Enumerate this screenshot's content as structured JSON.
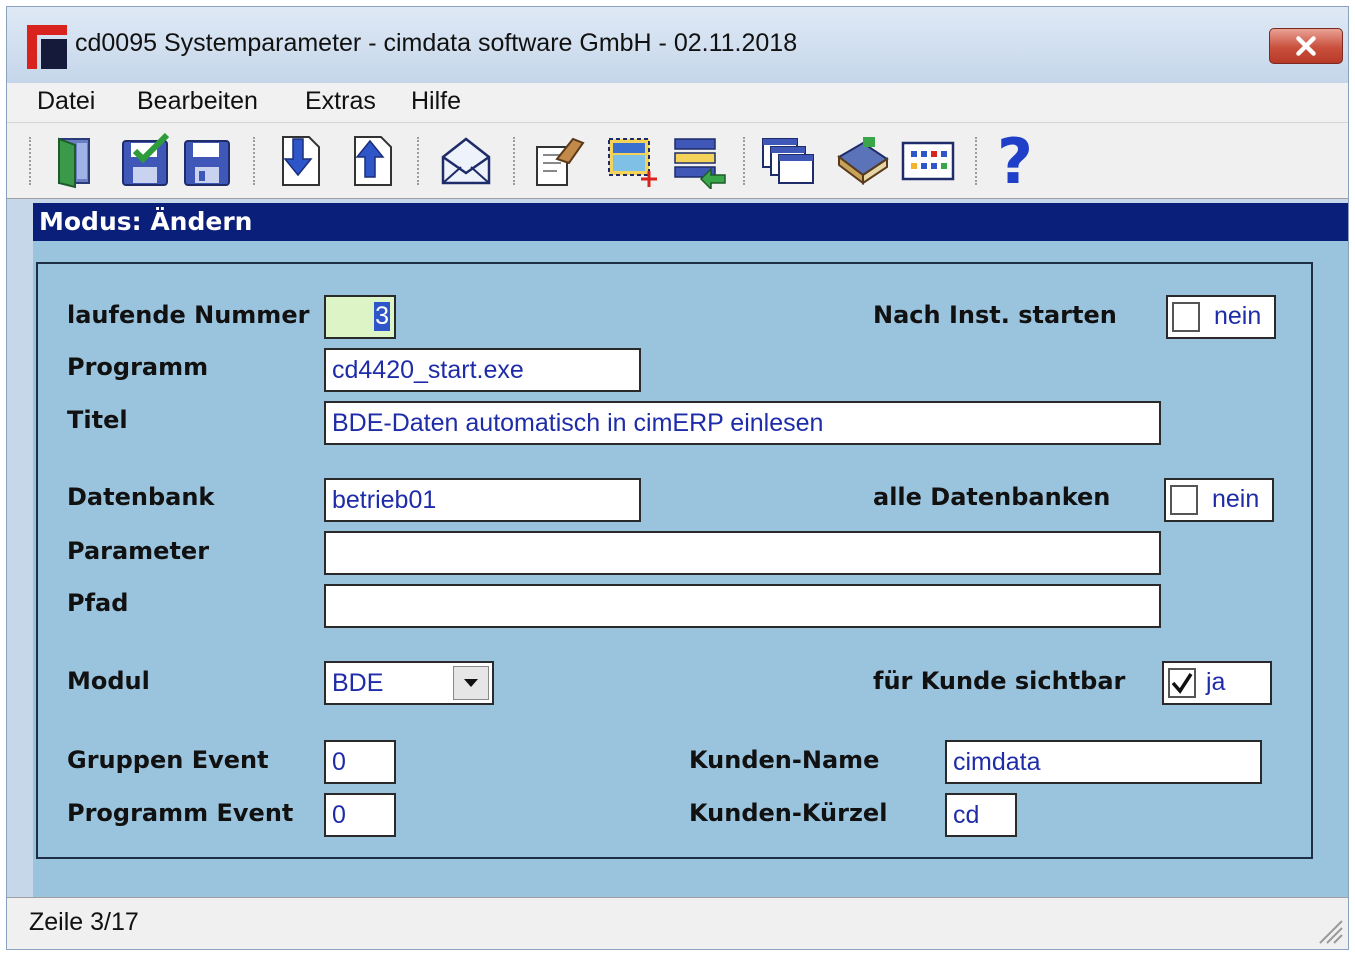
{
  "window": {
    "title": "cd0095 Systemparameter - cimdata software GmbH - 02.11.2018",
    "close_icon": "close-icon"
  },
  "menu": {
    "items": [
      {
        "label": "Datei"
      },
      {
        "label": "Bearbeiten"
      },
      {
        "label": "Extras"
      },
      {
        "label": "Hilfe"
      }
    ]
  },
  "toolbar": {
    "icons": [
      "exit-door-icon",
      "save-check-icon",
      "save-icon",
      "arrow-down-icon",
      "arrow-up-icon",
      "envelope-icon",
      "edit-hand-icon",
      "select-add-icon",
      "list-import-icon",
      "windows-icon",
      "book-icon",
      "grid-view-icon",
      "help-icon"
    ],
    "help_glyph": "?"
  },
  "mode": {
    "text": "Modus: Ändern"
  },
  "form": {
    "laufende_nummer": {
      "label": "laufende Nummer",
      "value": "3"
    },
    "programm": {
      "label": "Programm",
      "value": "cd4420_start.exe"
    },
    "titel": {
      "label": "Titel",
      "value": "BDE-Daten automatisch in cimERP einlesen"
    },
    "datenbank": {
      "label": "Datenbank",
      "value": "betrieb01"
    },
    "parameter": {
      "label": "Parameter",
      "value": ""
    },
    "pfad": {
      "label": "Pfad",
      "value": ""
    },
    "modul": {
      "label": "Modul",
      "value": "BDE"
    },
    "gruppen_event": {
      "label": "Gruppen Event",
      "value": "0"
    },
    "programm_event": {
      "label": "Programm Event",
      "value": "0"
    },
    "nach_inst_starten": {
      "label": "Nach Inst. starten",
      "checked": false,
      "text": "nein"
    },
    "alle_datenbanken": {
      "label": "alle Datenbanken",
      "checked": false,
      "text": "nein"
    },
    "fuer_kunde_sichtbar": {
      "label": "für Kunde sichtbar",
      "checked": true,
      "text": "ja"
    },
    "kunden_name": {
      "label": "Kunden-Name",
      "value": "cimdata"
    },
    "kunden_kuerzel": {
      "label": "Kunden-Kürzel",
      "value": "cd"
    }
  },
  "status": {
    "text": "Zeile 3/17"
  },
  "colors": {
    "mode_bar": "#0a1f7a",
    "form_bg": "#9ac3dd",
    "field_text": "#1f2ca8",
    "focused_field": "#ddf5c6"
  }
}
